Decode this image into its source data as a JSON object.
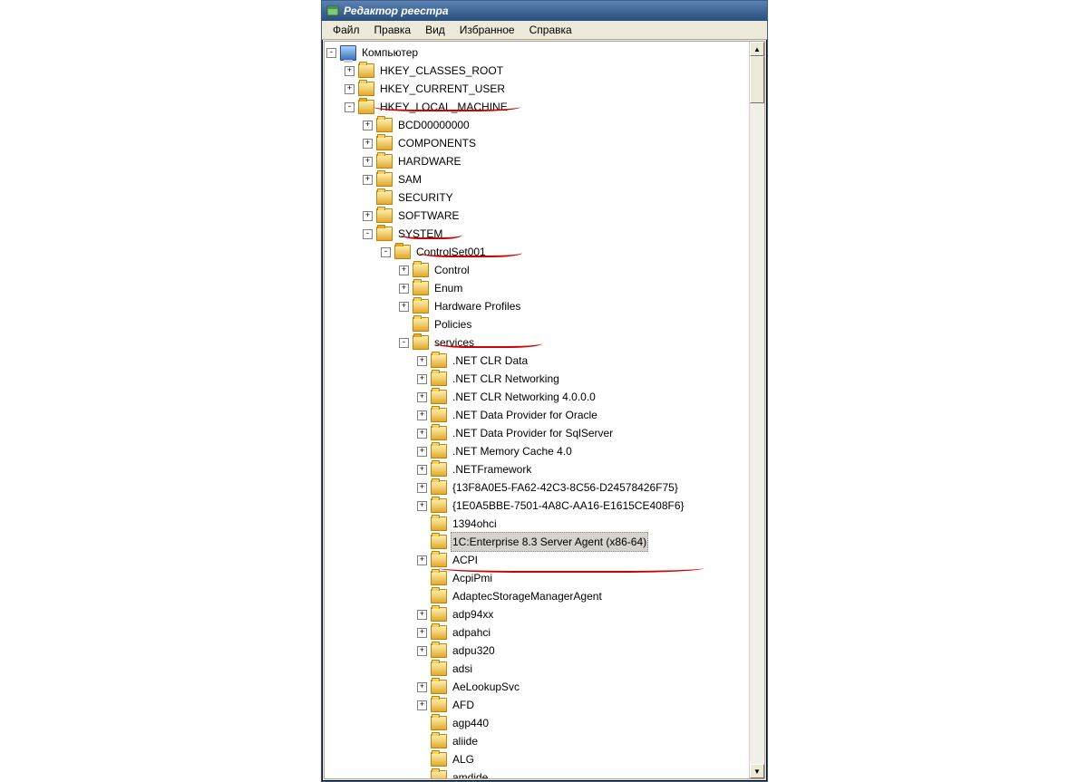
{
  "window": {
    "title": "Редактор реестра"
  },
  "menu": {
    "file": "Файл",
    "edit": "Правка",
    "view": "Вид",
    "favorites": "Избранное",
    "help": "Справка"
  },
  "tree": {
    "label": "Компьютер",
    "icon": "pc",
    "expander": "-",
    "children": [
      {
        "label": "HKEY_CLASSES_ROOT",
        "expander": "+"
      },
      {
        "label": "HKEY_CURRENT_USER",
        "expander": "+"
      },
      {
        "label": "HKEY_LOCAL_MACHINE",
        "expander": "-",
        "children": [
          {
            "label": "BCD00000000",
            "expander": "+"
          },
          {
            "label": "COMPONENTS",
            "expander": "+"
          },
          {
            "label": "HARDWARE",
            "expander": "+"
          },
          {
            "label": "SAM",
            "expander": "+"
          },
          {
            "label": "SECURITY",
            "expander": " "
          },
          {
            "label": "SOFTWARE",
            "expander": "+"
          },
          {
            "label": "SYSTEM",
            "expander": "-",
            "children": [
              {
                "label": "ControlSet001",
                "expander": "-",
                "children": [
                  {
                    "label": "Control",
                    "expander": "+"
                  },
                  {
                    "label": "Enum",
                    "expander": "+"
                  },
                  {
                    "label": "Hardware Profiles",
                    "expander": "+"
                  },
                  {
                    "label": "Policies",
                    "expander": " "
                  },
                  {
                    "label": "services",
                    "expander": "-",
                    "children": [
                      {
                        "label": ".NET CLR Data",
                        "expander": "+"
                      },
                      {
                        "label": ".NET CLR Networking",
                        "expander": "+"
                      },
                      {
                        "label": ".NET CLR Networking 4.0.0.0",
                        "expander": "+"
                      },
                      {
                        "label": ".NET Data Provider for Oracle",
                        "expander": "+"
                      },
                      {
                        "label": ".NET Data Provider for SqlServer",
                        "expander": "+"
                      },
                      {
                        "label": ".NET Memory Cache 4.0",
                        "expander": "+"
                      },
                      {
                        "label": ".NETFramework",
                        "expander": "+"
                      },
                      {
                        "label": "{13F8A0E5-FA62-42C3-8C56-D24578426F75}",
                        "expander": "+"
                      },
                      {
                        "label": "{1E0A5BBE-7501-4A8C-AA16-E1615CE408F6}",
                        "expander": "+"
                      },
                      {
                        "label": "1394ohci",
                        "expander": " "
                      },
                      {
                        "label": "1C:Enterprise 8.3 Server Agent (x86-64)",
                        "expander": " ",
                        "selected": true
                      },
                      {
                        "label": "ACPI",
                        "expander": "+"
                      },
                      {
                        "label": "AcpiPmi",
                        "expander": " "
                      },
                      {
                        "label": "AdaptecStorageManagerAgent",
                        "expander": " "
                      },
                      {
                        "label": "adp94xx",
                        "expander": "+"
                      },
                      {
                        "label": "adpahci",
                        "expander": "+"
                      },
                      {
                        "label": "adpu320",
                        "expander": "+"
                      },
                      {
                        "label": "adsi",
                        "expander": " "
                      },
                      {
                        "label": "AeLookupSvc",
                        "expander": "+"
                      },
                      {
                        "label": "AFD",
                        "expander": "+"
                      },
                      {
                        "label": "agp440",
                        "expander": " "
                      },
                      {
                        "label": "aliide",
                        "expander": " "
                      },
                      {
                        "label": "ALG",
                        "expander": " "
                      },
                      {
                        "label": "amdide",
                        "expander": " "
                      }
                    ]
                  }
                ]
              }
            ]
          }
        ]
      }
    ]
  }
}
